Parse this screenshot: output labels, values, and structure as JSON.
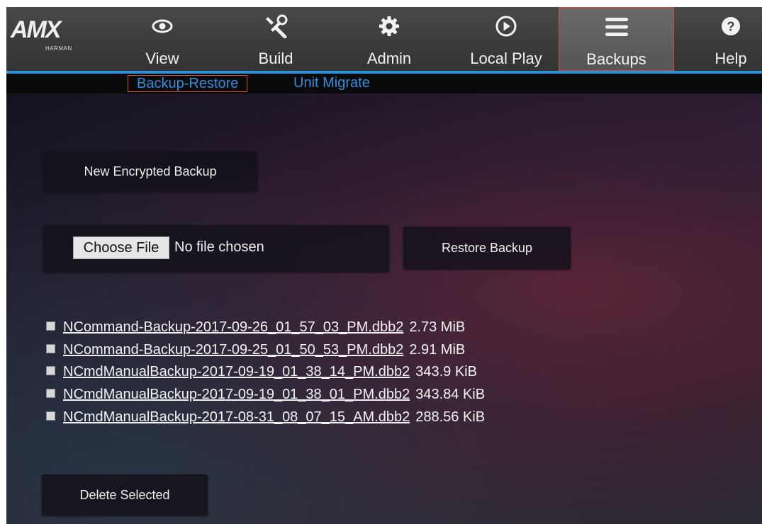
{
  "logo": {
    "name": "AMX",
    "sub": "HARMAN"
  },
  "nav": {
    "view": "View",
    "build": "Build",
    "admin": "Admin",
    "local_play": "Local Play",
    "backups": "Backups",
    "help": "Help"
  },
  "subnav": {
    "backup_restore": "Backup-Restore",
    "unit_migrate": "Unit Migrate"
  },
  "actions": {
    "new_backup": "New Encrypted Backup",
    "choose_file": "Choose File",
    "no_file": "No file chosen",
    "restore": "Restore Backup",
    "delete": "Delete Selected"
  },
  "backups": [
    {
      "file": "NCommand-Backup-2017-09-26_01_57_03_PM.dbb2",
      "size": "2.73 MiB"
    },
    {
      "file": "NCommand-Backup-2017-09-25_01_50_53_PM.dbb2",
      "size": "2.91 MiB"
    },
    {
      "file": "NCmdManualBackup-2017-09-19_01_38_14_PM.dbb2",
      "size": "343.9 KiB"
    },
    {
      "file": "NCmdManualBackup-2017-09-19_01_38_01_PM.dbb2",
      "size": "343.84 KiB"
    },
    {
      "file": "NCmdManualBackup-2017-08-31_08_07_15_AM.dbb2",
      "size": "288.56 KiB"
    }
  ],
  "colors": {
    "accent": "#2d8fd6",
    "active_border": "#d44a3a"
  },
  "icons": [
    "eye-icon",
    "wrench-icon",
    "gear-icon",
    "play-icon",
    "menu-icon",
    "help-icon"
  ]
}
